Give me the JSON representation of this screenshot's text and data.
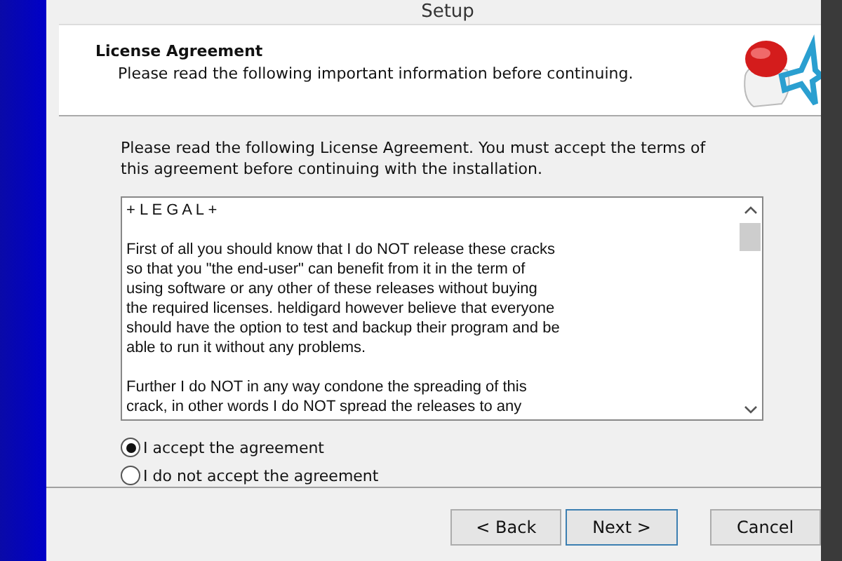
{
  "window": {
    "title": "Setup"
  },
  "header": {
    "title": "License Agreement",
    "subtitle": "Please read the following important information before continuing."
  },
  "intro": "Please read the following License Agreement. You must accept the terms of this agreement before continuing with the installation.",
  "license_text": [
    "+ L E G A L +",
    "First of all you should know that I do NOT release these cracks\nso that you \"the end-user\" can benefit from it in the term of\nusing software or any other of these releases without buying\nthe required licenses. heldigard however believe that everyone\nshould have the option to test and backup their program and be\nable to run it without any problems.",
    "Further I do NOT in any way condone the spreading of this\ncrack, in other words I do NOT spread the releases to any"
  ],
  "options": [
    {
      "label": "I accept the agreement",
      "selected": true
    },
    {
      "label": "I do not accept the agreement",
      "selected": false
    }
  ],
  "buttons": [
    {
      "label": "< Back",
      "kind": "normal"
    },
    {
      "label": "Next >",
      "kind": "default"
    },
    {
      "label": "Cancel",
      "kind": "normal"
    }
  ]
}
